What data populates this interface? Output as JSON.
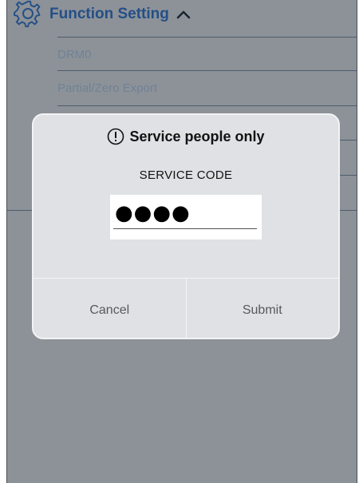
{
  "header": {
    "title": "Function Setting"
  },
  "menu": {
    "items": [
      {
        "label": "DRM0"
      },
      {
        "label": "Partial/Zero Export"
      }
    ]
  },
  "dialog": {
    "title": "Service people only",
    "field_label": "SERVICE CODE",
    "code_value": "●●●●",
    "cancel_label": "Cancel",
    "submit_label": "Submit"
  },
  "colors": {
    "accent": "#244f86",
    "overlay": "#8d9298",
    "dialog_bg": "#dfe1e4"
  },
  "icons": {
    "header": "gear-icon",
    "toggle": "chevron-up-icon",
    "dialog": "exclamation-circle-icon"
  }
}
